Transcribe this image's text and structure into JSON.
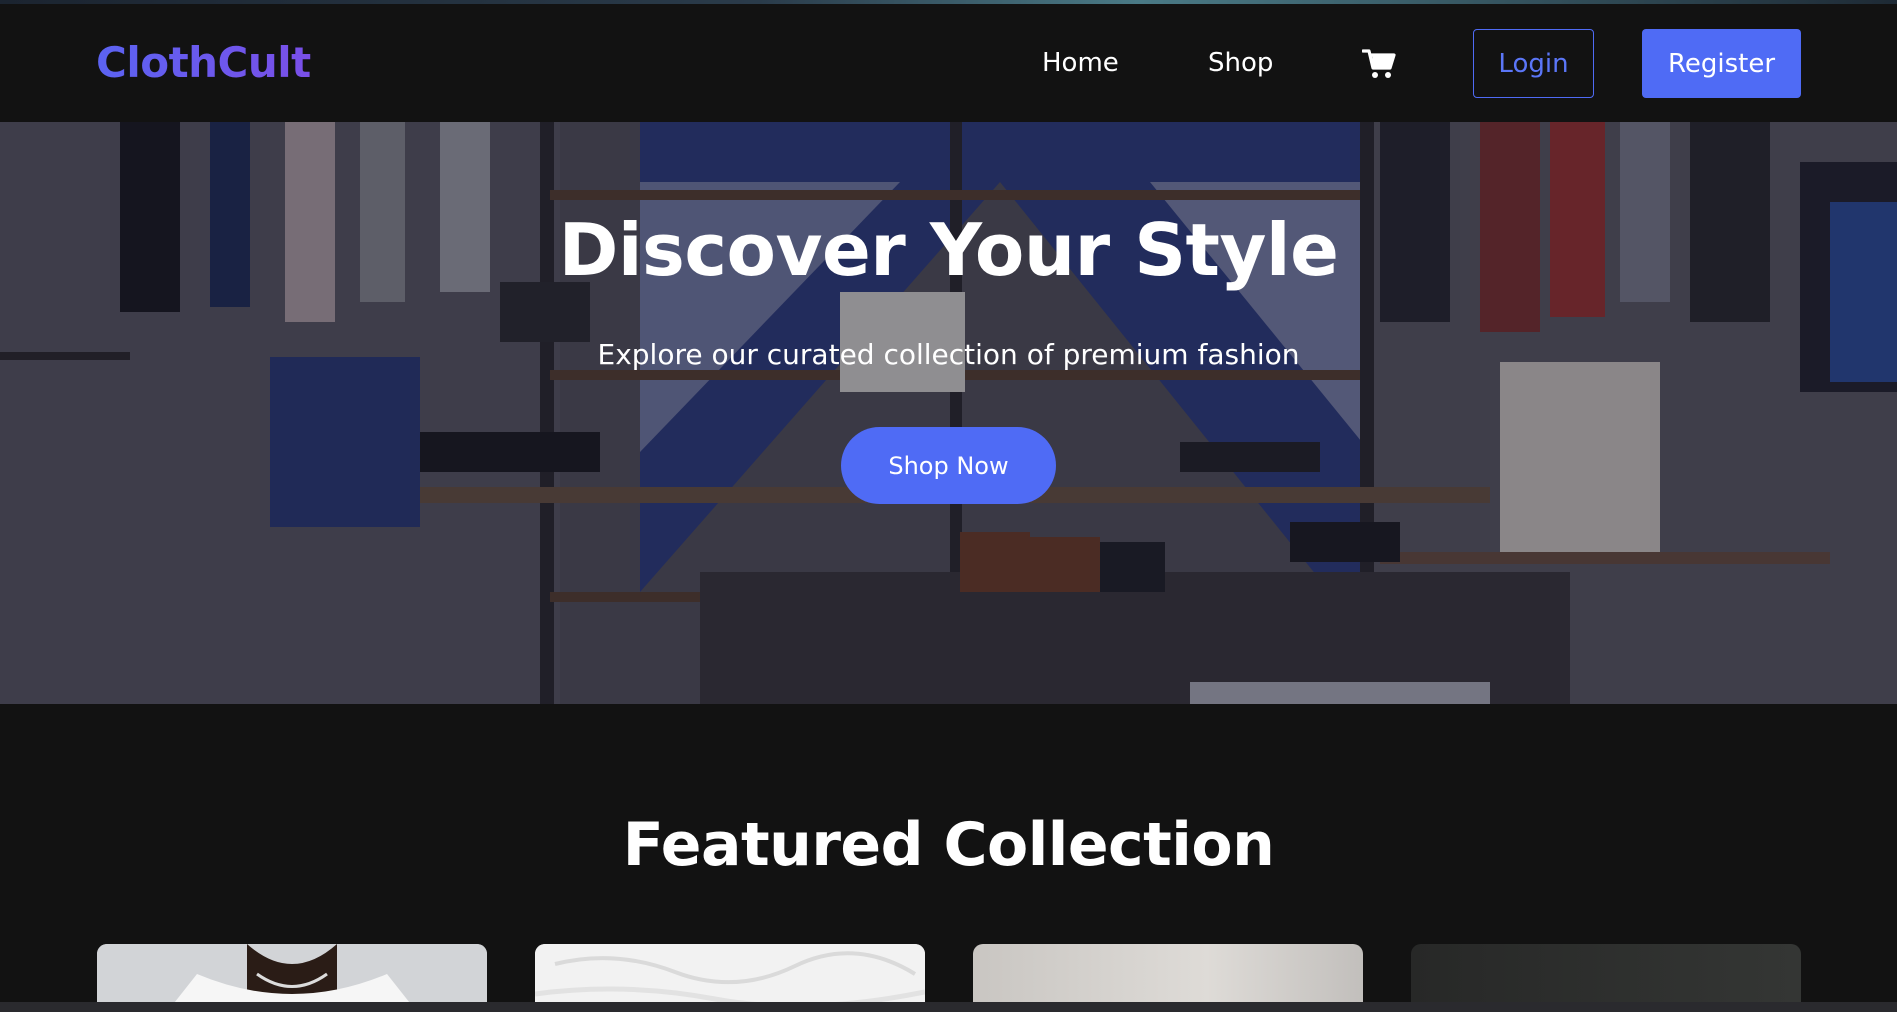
{
  "brand": {
    "name": "ClothCult"
  },
  "nav": {
    "home_label": "Home",
    "shop_label": "Shop",
    "cart_icon": "cart-icon",
    "login_label": "Login",
    "register_label": "Register"
  },
  "hero": {
    "title": "Discover Your Style",
    "subtitle": "Explore our curated collection of premium fashion",
    "cta_label": "Shop Now"
  },
  "featured": {
    "title": "Featured Collection"
  },
  "colors": {
    "accent": "#4f6bf5",
    "logo_gradient_start": "#5b63f2",
    "logo_gradient_end": "#7a4fe8",
    "background": "#121212"
  }
}
